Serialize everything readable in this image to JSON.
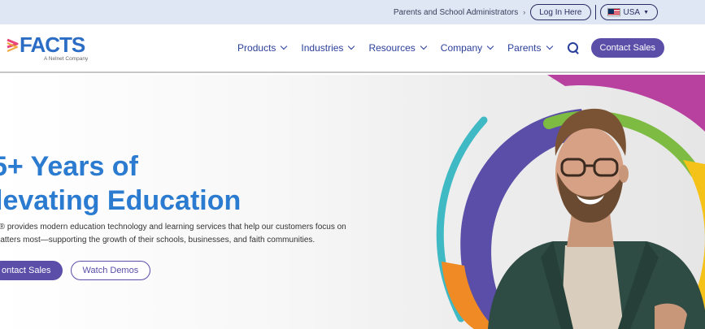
{
  "utility": {
    "parents_text": "Parents and School Administrators",
    "chevron": "›",
    "login_label": "Log In Here",
    "region_label": "USA",
    "region_chevron": "▼"
  },
  "nav": {
    "logo_text": "FACTS",
    "logo_sub": "A Nelnet Company",
    "items": [
      {
        "label": "Products"
      },
      {
        "label": "Industries"
      },
      {
        "label": "Resources"
      },
      {
        "label": "Company"
      },
      {
        "label": "Parents"
      }
    ],
    "contact_label": "Contact Sales"
  },
  "hero": {
    "title_line1": "5+ Years of",
    "title_line2": "levating Education",
    "desc_line1": "S® provides modern education technology and learning services that help our customers focus on",
    "desc_line2": "matters most—supporting the growth of their schools, businesses, and faith communities.",
    "primary_label": "ontact Sales",
    "secondary_label": "Watch Demos"
  },
  "colors": {
    "brand_blue": "#2b7bd0",
    "purple": "#5a4ea8",
    "nav_blue": "#2a3f9a",
    "utility_bg": "#dfe7f4"
  }
}
